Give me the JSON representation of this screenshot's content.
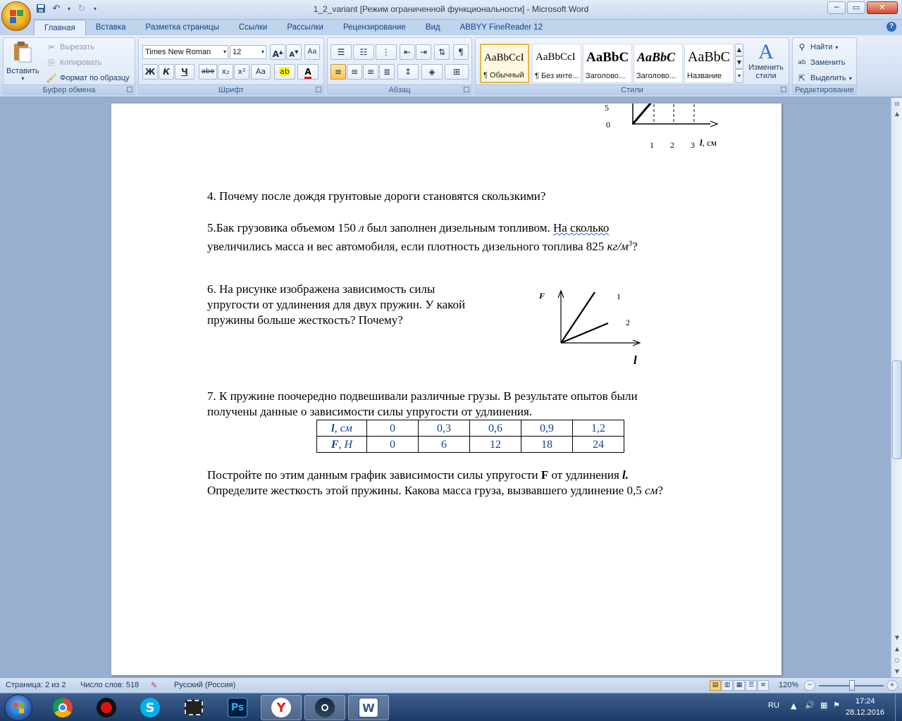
{
  "window": {
    "title": "1_2_variant [Режим ограниченной функциональности] - Microsoft Word",
    "min": "─",
    "max": "▭",
    "close": "✕"
  },
  "qat": {
    "save_icon": "save-icon",
    "undo_icon": "undo-icon",
    "redo_icon": "redo-icon",
    "customize_icon": "customize-icon"
  },
  "tabs": [
    {
      "label": "Главная"
    },
    {
      "label": "Вставка"
    },
    {
      "label": "Разметка страницы"
    },
    {
      "label": "Ссылки"
    },
    {
      "label": "Рассылки"
    },
    {
      "label": "Рецензирование"
    },
    {
      "label": "Вид"
    },
    {
      "label": "ABBYY FineReader 12"
    }
  ],
  "clipboard": {
    "label": "Буфер обмена",
    "paste": "Вставить",
    "cut": "Вырезать",
    "copy": "Копировать",
    "format_painter": "Формат по образцу"
  },
  "font": {
    "label": "Шрифт",
    "name": "Times New Roman",
    "size": "12",
    "grow": "A",
    "shrink": "A",
    "clear": "Aa",
    "bold": "Ж",
    "italic": "К",
    "underline": "Ч",
    "strike": "abe",
    "sub": "x₂",
    "sup": "x²",
    "case": "Aa",
    "highlight": "ab",
    "color": "A"
  },
  "paragraph": {
    "label": "Абзац"
  },
  "styles": {
    "label": "Стили",
    "change": "Изменить стили",
    "items": [
      {
        "sample": "AaBbCcI",
        "name": "¶ Обычный"
      },
      {
        "sample": "AaBbCcI",
        "name": "¶ Без инте..."
      },
      {
        "sample": "AaBbC",
        "name": "Заголово..."
      },
      {
        "sample": "AaBbC",
        "name": "Заголово..."
      },
      {
        "sample": "AaBbC",
        "name": "Название"
      }
    ]
  },
  "editing": {
    "label": "Редактирование",
    "find": "Найти",
    "replace": "Заменить",
    "select": "Выделить"
  },
  "doc": {
    "top_graph": {
      "tick_y": "5",
      "origin": "0",
      "ticks_x": [
        "1",
        "2",
        "3"
      ],
      "axis_label": "l",
      "axis_unit": ", см"
    },
    "q4": "4. Почему после дождя грунтовые дороги становятся скользкими?",
    "q5_line1_a": "5.Бак грузовика объемом 150 ",
    "q5_line1_unit": "л",
    "q5_line1_b": " был заполнен дизельным топливом. ",
    "q5_line1_c": "На сколько",
    "q5_line2_a": "увеличились масса и  вес автомобиля, если плотность дизельного топлива 825 ",
    "q5_line2_unit": "кг/м",
    "q5_line2_sup": "3",
    "q5_line2_end": "?",
    "q6_line1": "6. На рисунке изображена зависимость силы",
    "q6_line2": "упругости от удлинения для двух пружин. У какой",
    "q6_line3": "пружины больше жесткость?  Почему?",
    "fig6": {
      "y_label": "F",
      "x_label": "l",
      "line1": "1",
      "line2": "2"
    },
    "q7_line1": "   7. К пружине поочередно подвешивали различные грузы. В результате опытов были",
    "q7_line2": "получены данные о зависимости силы упругости от удлинения.",
    "table": {
      "row1_head_var": "l",
      "row1_head_unit": ", см",
      "row1": [
        "0",
        "0,3",
        "0,6",
        "0,9",
        "1,2"
      ],
      "row2_head_var": "F",
      "row2_head_unit": ", Н",
      "row2": [
        "0",
        "6",
        "12",
        "18",
        "24"
      ]
    },
    "q7b_line1_a": " Постройте по этим данным график зависимости силы упругости ",
    "q7b_line1_F": "F",
    "q7b_line1_b": " от удлинения ",
    "q7b_line1_l": "l.",
    "q7b_line2_a": "Определите жесткость  этой пружины. Какова масса груза, вызвавшего удлинение 0,5 ",
    "q7b_line2_unit": "см",
    "q7b_line2_end": "?"
  },
  "status": {
    "page": "Страница: 2 из 2",
    "words": "Число слов: 518",
    "lang": "Русский (Россия)",
    "zoom": "120%"
  },
  "taskbar": {
    "apps": [
      {
        "name": "chrome-icon"
      },
      {
        "name": "record-icon"
      },
      {
        "name": "skype-icon",
        "letter": "S"
      },
      {
        "name": "video-icon"
      },
      {
        "name": "photoshop-icon",
        "letter": "Ps"
      },
      {
        "name": "yandex-icon",
        "letter": "Y"
      },
      {
        "name": "steam-icon"
      },
      {
        "name": "word-icon",
        "letter": "W"
      }
    ],
    "lang": "RU",
    "time": "17:24",
    "date": "28.12.2016"
  }
}
